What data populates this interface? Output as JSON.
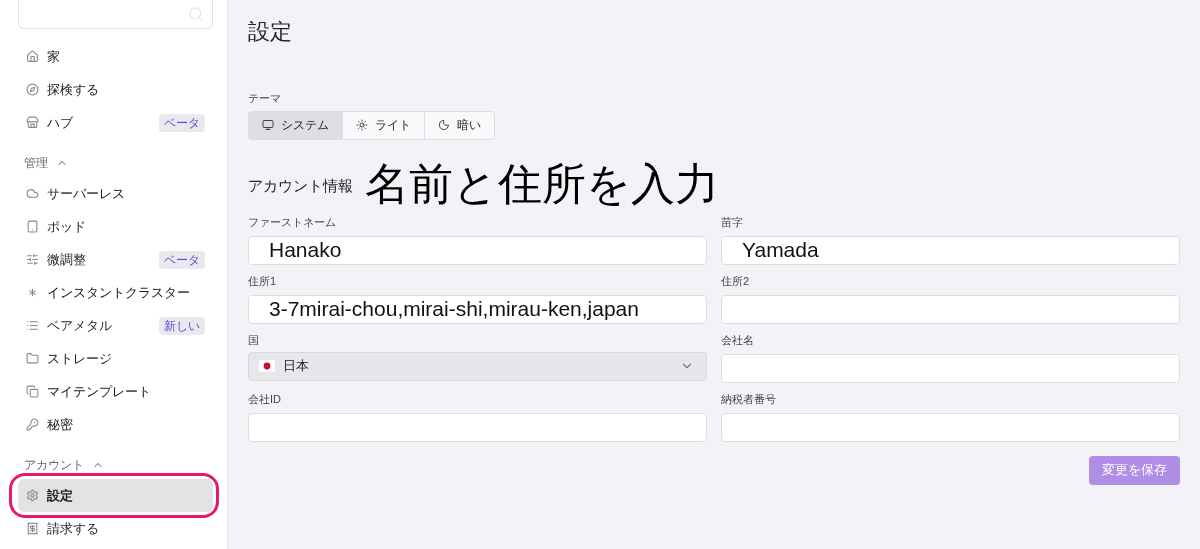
{
  "sidebar": {
    "sections": [
      {
        "items": [
          {
            "label": "家",
            "selected": false,
            "circled": false
          },
          {
            "label": "探検する",
            "selected": false,
            "circled": false
          },
          {
            "label": "ハブ",
            "badge": "ベータ",
            "selected": false,
            "circled": false
          }
        ]
      },
      {
        "heading": "管理",
        "expanded": true,
        "items": [
          {
            "label": "サーバーレス",
            "selected": false,
            "circled": false
          },
          {
            "label": "ポッド",
            "selected": false,
            "circled": false
          },
          {
            "label": "微調整",
            "badge": "ベータ",
            "selected": false,
            "circled": false
          },
          {
            "label": "インスタントクラスター",
            "selected": false,
            "circled": false
          },
          {
            "label": "ベアメタル",
            "badge": "新しい",
            "selected": false,
            "circled": false
          },
          {
            "label": "ストレージ",
            "selected": false,
            "circled": false
          },
          {
            "label": "マイテンプレート",
            "selected": false,
            "circled": false
          },
          {
            "label": "秘密",
            "selected": false,
            "circled": false
          }
        ]
      },
      {
        "heading": "アカウント",
        "expanded": true,
        "items": [
          {
            "label": "設定",
            "selected": true,
            "circled": true
          },
          {
            "label": "請求する",
            "selected": false,
            "circled": false
          }
        ]
      }
    ]
  },
  "main": {
    "title": "設定",
    "theme": {
      "label": "テーマ",
      "options": [
        {
          "label": "システム",
          "selected": true
        },
        {
          "label": "ライト",
          "selected": false
        },
        {
          "label": "暗い",
          "selected": false
        }
      ]
    },
    "account": {
      "heading": "アカウント情報",
      "annotation": "名前と住所を入力",
      "fields": [
        {
          "kind": "text",
          "label": "ファーストネーム",
          "value": "Hanako"
        },
        {
          "kind": "text",
          "label": "苗字",
          "value": "Yamada"
        },
        {
          "kind": "text",
          "label": "住所1",
          "value": "3-7mirai-chou,mirai-shi,mirau-ken,japan"
        },
        {
          "kind": "text",
          "label": "住所2"
        },
        {
          "kind": "select",
          "label": "国",
          "value": "日本"
        },
        {
          "kind": "text",
          "label": "会社名"
        },
        {
          "kind": "text",
          "label": "会社ID"
        },
        {
          "kind": "text",
          "label": "納税者番号"
        }
      ],
      "save": "変更を保存"
    }
  }
}
